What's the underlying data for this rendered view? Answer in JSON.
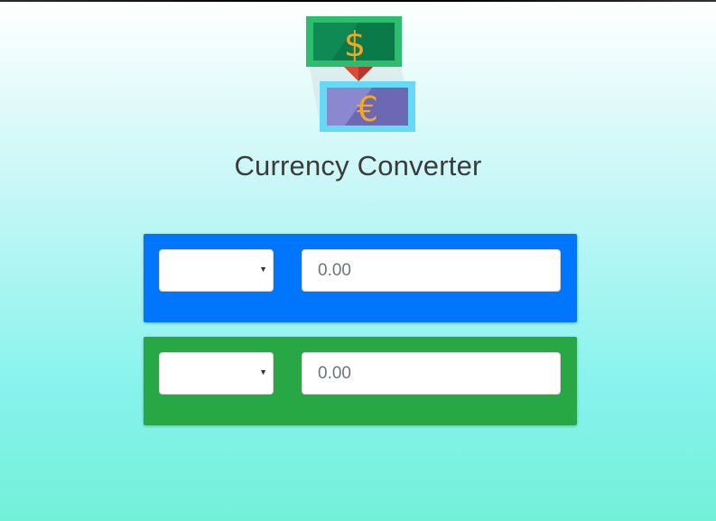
{
  "app": {
    "title": "Currency Converter"
  },
  "logo": {
    "from_symbol": "$",
    "to_symbol": "€"
  },
  "converter": {
    "from": {
      "currency_selected": "",
      "amount_placeholder": "0.00",
      "color": "#0076fc"
    },
    "to": {
      "currency_selected": "",
      "amount_placeholder": "0.00",
      "color": "#28a745"
    }
  }
}
